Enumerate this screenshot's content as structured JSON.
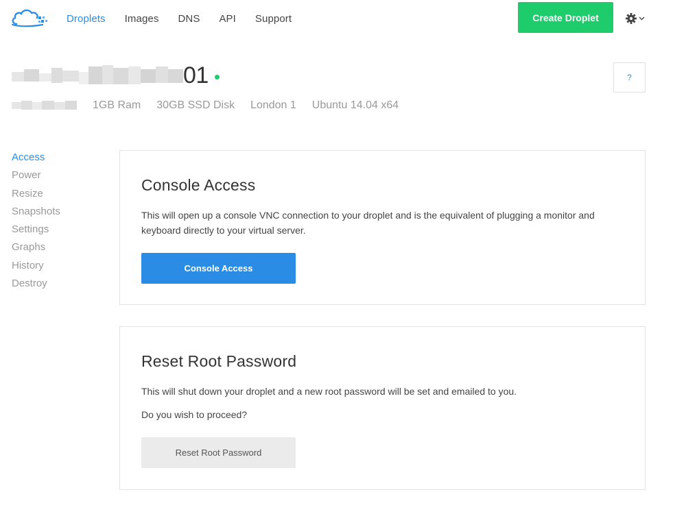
{
  "nav": {
    "items": [
      {
        "label": "Droplets",
        "active": true
      },
      {
        "label": "Images",
        "active": false
      },
      {
        "label": "DNS",
        "active": false
      },
      {
        "label": "API",
        "active": false
      },
      {
        "label": "Support",
        "active": false
      }
    ],
    "create_label": "Create Droplet",
    "logo_icon": "digitalocean-cloud-logo",
    "settings_icon": "gear-icon"
  },
  "droplet": {
    "name_suffix": "01",
    "status_color": "#1fcc6b",
    "help_label": "?",
    "specs": {
      "ram": "1GB Ram",
      "disk": "30GB SSD Disk",
      "region": "London 1",
      "os": "Ubuntu 14.04 x64"
    }
  },
  "sidebar": {
    "items": [
      {
        "label": "Access",
        "active": true
      },
      {
        "label": "Power",
        "active": false
      },
      {
        "label": "Resize",
        "active": false
      },
      {
        "label": "Snapshots",
        "active": false
      },
      {
        "label": "Settings",
        "active": false
      },
      {
        "label": "Graphs",
        "active": false
      },
      {
        "label": "History",
        "active": false
      },
      {
        "label": "Destroy",
        "active": false
      }
    ]
  },
  "console": {
    "title": "Console Access",
    "description": "This will open up a console VNC connection to your droplet and is the equivalent of plugging a monitor and keyboard directly to your virtual server.",
    "button_label": "Console Access"
  },
  "reset": {
    "title": "Reset Root Password",
    "description": "This will shut down your droplet and a new root password will be set and emailed to you.",
    "question": "Do you wish to proceed?",
    "button_label": "Reset Root Password"
  },
  "colors": {
    "accent": "#2b8ce6",
    "create": "#1fcc6b",
    "muted": "#999999"
  }
}
